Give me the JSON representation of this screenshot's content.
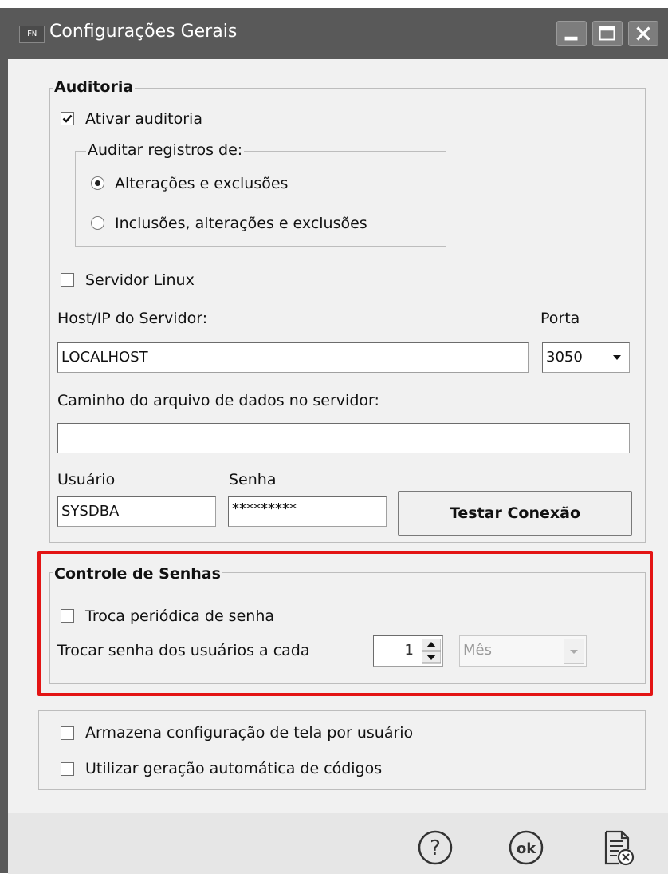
{
  "window": {
    "icon_text": "FN",
    "title": "Configurações Gerais",
    "buttons": [
      "minimize-icon",
      "maximize-icon",
      "close-icon"
    ]
  },
  "auditoria": {
    "title": "Auditoria",
    "enable_label": "Ativar auditoria",
    "enable_checked": true,
    "registros": {
      "title": "Auditar registros de:",
      "options": [
        "Alterações e exclusões",
        "Inclusões, alterações e exclusões"
      ],
      "selected_index": 0
    },
    "linux_label": "Servidor Linux",
    "linux_checked": false,
    "host_label": "Host/IP do Servidor:",
    "host_value": "LOCALHOST",
    "port_label": "Porta",
    "port_value": "3050",
    "path_label": "Caminho do arquivo de dados no servidor:",
    "path_value": "",
    "user_label": "Usuário",
    "user_value": "SYSDBA",
    "password_label": "Senha",
    "password_value": "*********",
    "test_button": "Testar Conexão"
  },
  "senhas": {
    "title": "Controle de Senhas",
    "periodic_label": "Troca periódica de senha",
    "periodic_checked": false,
    "interval_label": "Trocar senha dos usuários a cada",
    "interval_value": "1",
    "unit_value": "Mês"
  },
  "extras": {
    "screen_config_label": "Armazena configuração de tela por usuário",
    "auto_codes_label": "Utilizar geração automática de códigos"
  },
  "footer": {
    "icons": [
      "help-icon",
      "ok-icon",
      "cancel-document-icon"
    ],
    "ok_text": "ok",
    "help_text": "?"
  },
  "colors": {
    "titlebar": "#595959",
    "highlight": "#e31414",
    "background": "#f1f1f1"
  }
}
